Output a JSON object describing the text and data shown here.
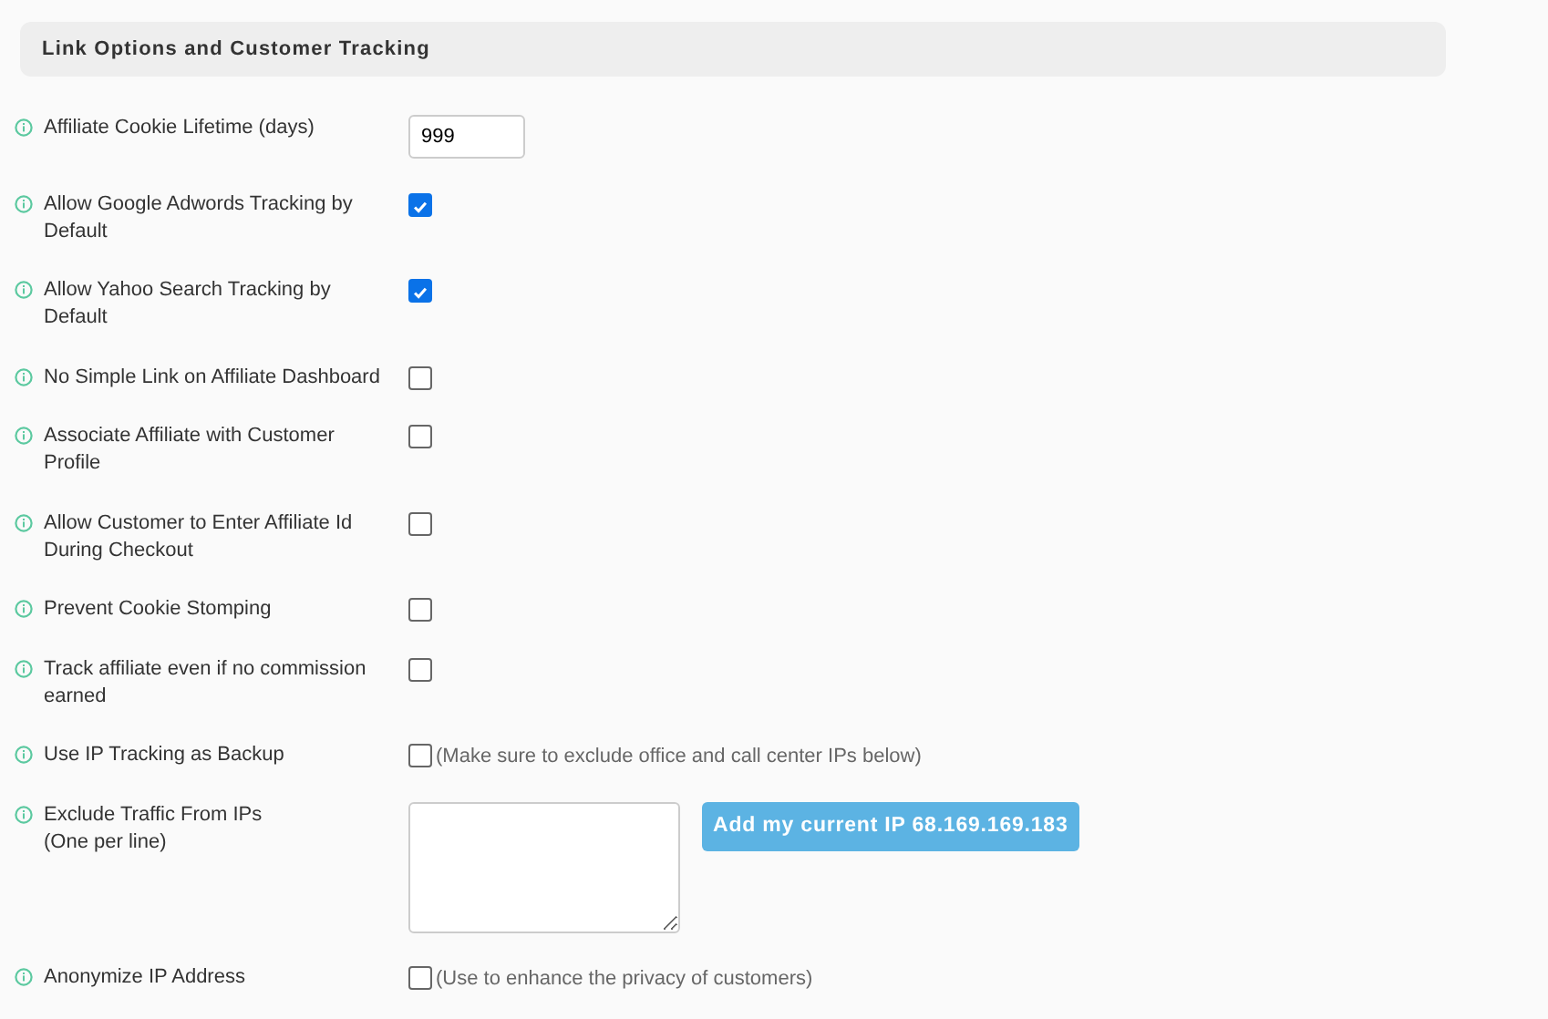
{
  "section": {
    "title": "Link Options and Customer Tracking"
  },
  "rows": [
    {
      "kind": "text",
      "label": "Affiliate Cookie Lifetime (days)",
      "value": "999"
    },
    {
      "kind": "checkbox",
      "label": "Allow Google Adwords Tracking by Default",
      "checked": true
    },
    {
      "kind": "checkbox",
      "label": "Allow Yahoo Search Tracking by Default",
      "checked": true
    },
    {
      "kind": "checkbox",
      "label": "No Simple Link on Affiliate Dashboard",
      "checked": false
    },
    {
      "kind": "checkbox",
      "label": "Associate Affiliate with Customer Profile",
      "checked": false
    },
    {
      "kind": "checkbox",
      "label": "Allow Customer to Enter Affiliate Id During Checkout",
      "checked": false
    },
    {
      "kind": "checkbox",
      "label": "Prevent Cookie Stomping",
      "checked": false
    },
    {
      "kind": "checkbox",
      "label": "Track affiliate even if no commission earned",
      "checked": false
    },
    {
      "kind": "checkbox",
      "label": "Use IP Tracking as Backup",
      "checked": false,
      "note": "(Make sure to exclude office and call center IPs below)"
    },
    {
      "kind": "textarea",
      "label": "Exclude Traffic From IPs",
      "hint": "(One per line)",
      "button": "Add my current IP 68.169.169.183"
    },
    {
      "kind": "checkbox",
      "label": "Anonymize IP Address",
      "checked": false,
      "note": "(Use to enhance the privacy of customers)"
    }
  ]
}
